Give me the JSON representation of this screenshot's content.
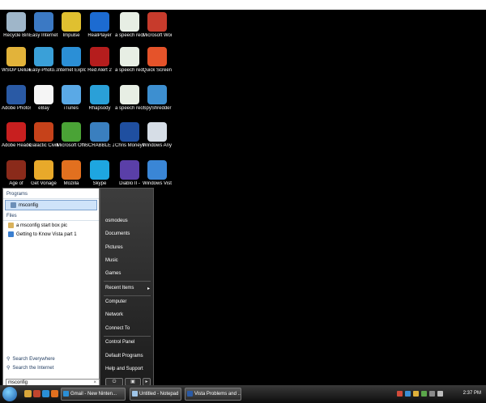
{
  "desktop_icons": [
    {
      "label": "Recycle Bin",
      "icon": "recycle-bin-icon",
      "color": "#9fb6c9"
    },
    {
      "label": "Easy Internet Services",
      "icon": "globe-icon",
      "color": "#3b79c4"
    },
    {
      "label": "Impulse",
      "icon": "impulse-icon",
      "color": "#e0c030"
    },
    {
      "label": "RealPlayer",
      "icon": "realplayer-icon",
      "color": "#1c6bd1"
    },
    {
      "label": "a speech recogniti...",
      "icon": "document-icon",
      "color": "#e7eee4"
    },
    {
      "label": "Microsoft Works",
      "icon": "works-icon",
      "color": "#c73b2c"
    },
    {
      "label": "WSOP Deluxe C...",
      "icon": "horseshoe-icon",
      "color": "#e2b33a"
    },
    {
      "label": "Easy-Photo...",
      "icon": "photo-icon",
      "color": "#3aa0d8"
    },
    {
      "label": "Internet Explorer",
      "icon": "internet-explorer-icon",
      "color": "#2b8fd6"
    },
    {
      "label": "Red Alert 2",
      "icon": "red-alert-icon",
      "color": "#b51d1d"
    },
    {
      "label": "a speech recogniti...",
      "icon": "document-icon",
      "color": "#e7eee4"
    },
    {
      "label": "Quick Screen Capture",
      "icon": "capture-icon",
      "color": "#e5532a"
    },
    {
      "label": "Adobe Photosh...",
      "icon": "photoshop-icon",
      "color": "#2a5aa5"
    },
    {
      "label": "eBay",
      "icon": "ebay-icon",
      "color": "#f5f5f5"
    },
    {
      "label": "iTunes",
      "icon": "itunes-icon",
      "color": "#5aa9e6"
    },
    {
      "label": "Rhapsody",
      "icon": "rhapsody-icon",
      "color": "#2aa0d8"
    },
    {
      "label": "a speech recogniti...",
      "icon": "document-icon",
      "color": "#e7eee4"
    },
    {
      "label": "SpyShredder",
      "icon": "spyshredder-icon",
      "color": "#3d8fd0"
    },
    {
      "label": "Adobe Reader 8",
      "icon": "adobe-reader-icon",
      "color": "#c81f1f"
    },
    {
      "label": "Galactic Civilizatio...",
      "icon": "galactic-icon",
      "color": "#c6421a"
    },
    {
      "label": "Microsoft Office -...",
      "icon": "office-icon",
      "color": "#4aa336"
    },
    {
      "label": "SCRABBLE Journey",
      "icon": "scrabble-icon",
      "color": "#3a7fbf"
    },
    {
      "label": "Chris Moneymak...",
      "icon": "poker-icon",
      "color": "#1f4fa0"
    },
    {
      "label": "Windows Anytim...",
      "icon": "windows-anytime-icon",
      "color": "#d6dde6"
    },
    {
      "label": "Age of",
      "icon": "age-of-icon",
      "color": "#8a2a1a"
    },
    {
      "label": "Get Vonage",
      "icon": "vonage-icon",
      "color": "#e8a92a"
    },
    {
      "label": "Mozilla",
      "icon": "firefox-icon",
      "color": "#e2701f"
    },
    {
      "label": "Skype",
      "icon": "skype-icon",
      "color": "#1ea6e0"
    },
    {
      "label": "Diablo II -",
      "icon": "diablo-icon",
      "color": "#5a3fa8"
    },
    {
      "label": "Windows Vista U...",
      "icon": "vista-upgrade-icon",
      "color": "#3a86d6"
    }
  ],
  "start_menu": {
    "section_programs": "Programs",
    "program_results": [
      {
        "label": "msconfig",
        "icon": "msconfig-icon",
        "color": "#6c8fb8"
      }
    ],
    "section_files": "Files",
    "file_results": [
      {
        "label": "a msconfig start box pic",
        "icon": "image-file-icon",
        "color": "#d9b25c"
      },
      {
        "label": "Getting to Know Vista part 1",
        "icon": "web-document-icon",
        "color": "#3b7fd0"
      }
    ],
    "search_everywhere": "Search Everywhere",
    "search_internet": "Search the Internet",
    "search_value": "msconfig",
    "right_items": [
      "osmodeus",
      "Documents",
      "Pictures",
      "Music",
      "Games",
      "Recent Items",
      "Computer",
      "Network",
      "Connect To",
      "Control Panel",
      "Default Programs",
      "Help and Support"
    ]
  },
  "taskbar": {
    "tasks": [
      {
        "label": "Gmail - New Ninten...",
        "icon": "ie-icon",
        "color": "#2b8fd6"
      },
      {
        "label": "Untitled - Notepad",
        "icon": "notepad-icon",
        "color": "#9fc5e8"
      },
      {
        "label": "Vista Problems and ...",
        "icon": "word-icon",
        "color": "#2a5aa5"
      }
    ],
    "clock": "2:37 PM"
  }
}
